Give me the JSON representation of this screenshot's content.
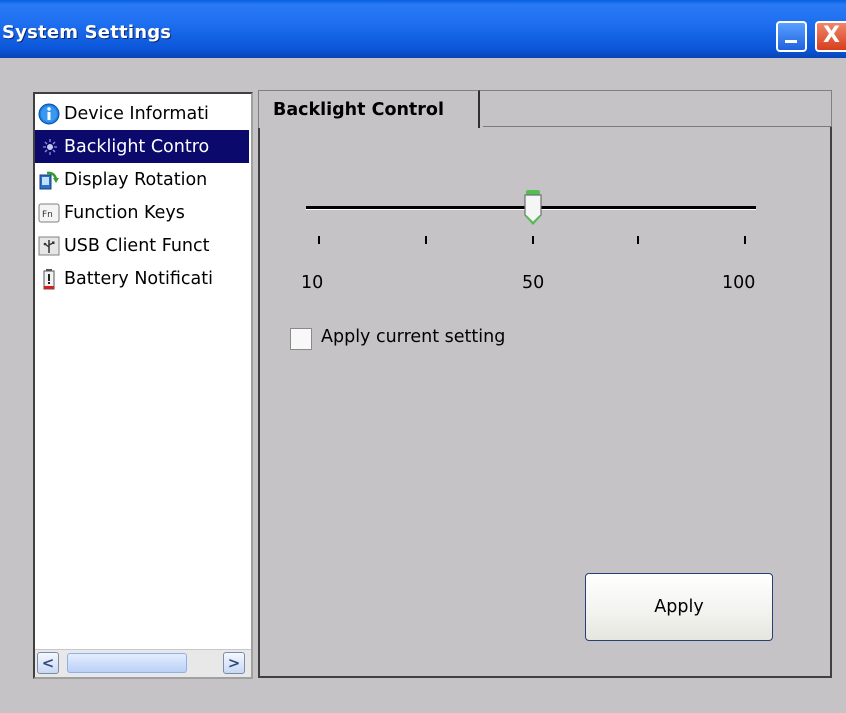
{
  "window": {
    "title": "System Settings",
    "minimize_icon": "minimize-icon",
    "close_label": "X"
  },
  "sidebar": {
    "items": [
      {
        "label": "Device Informati",
        "icon": "info-icon",
        "selected": false
      },
      {
        "label": "Backlight Contro",
        "icon": "backlight-icon",
        "selected": true
      },
      {
        "label": "Display Rotation",
        "icon": "display-rotation-icon",
        "selected": false
      },
      {
        "label": "Function Keys",
        "icon": "function-keys-icon",
        "selected": false
      },
      {
        "label": "USB Client Funct",
        "icon": "usb-icon",
        "selected": false
      },
      {
        "label": "Battery Notificati",
        "icon": "battery-icon",
        "selected": false
      }
    ],
    "scroll_left": "<",
    "scroll_right": ">"
  },
  "tab": {
    "label": "Backlight Control"
  },
  "slider": {
    "value": 50,
    "min_label": "10",
    "mid_label": "50",
    "max_label": "100"
  },
  "checkbox": {
    "label": "Apply current setting",
    "checked": false
  },
  "buttons": {
    "apply": "Apply"
  }
}
